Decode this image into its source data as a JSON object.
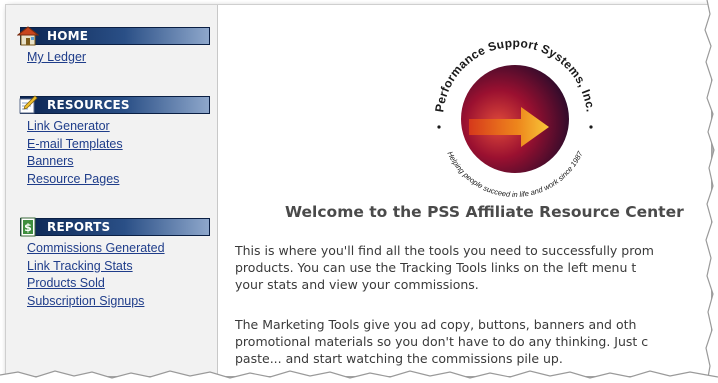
{
  "sidebar": {
    "sections": [
      {
        "title": "HOME",
        "icon": "home-icon",
        "links": [
          "My Ledger"
        ]
      },
      {
        "title": "RESOURCES",
        "icon": "pencil-note-icon",
        "links": [
          "Link Generator",
          "E-mail Templates",
          "Banners",
          "Resource Pages"
        ]
      },
      {
        "title": "REPORTS",
        "icon": "dollar-document-icon",
        "links": [
          "Commissions Generated",
          "Link Tracking Stats",
          "Products Sold",
          "Subscription Signups"
        ]
      }
    ]
  },
  "logo": {
    "top_text": "Performance Support Systems, Inc.",
    "bottom_text": "Helping people succeed in life and work since 1987"
  },
  "main": {
    "heading": "Welcome to the PSS Affiliate Resource Center",
    "paragraph1": [
      "This is where you'll find all the tools you need to successfully prom",
      "products. You can use the Tracking Tools links on the left menu t",
      "your stats and view your commissions."
    ],
    "paragraph2": [
      "The Marketing Tools give you ad copy, buttons, banners and oth",
      "promotional materials so you don't have to do any thinking. Just c",
      "paste... and start watching the commissions pile up."
    ]
  },
  "colors": {
    "header_dark": "#0b2552",
    "header_light": "#8ea7cb",
    "link": "#1f3d8a",
    "sidebar_bg": "#f2f2f2"
  }
}
